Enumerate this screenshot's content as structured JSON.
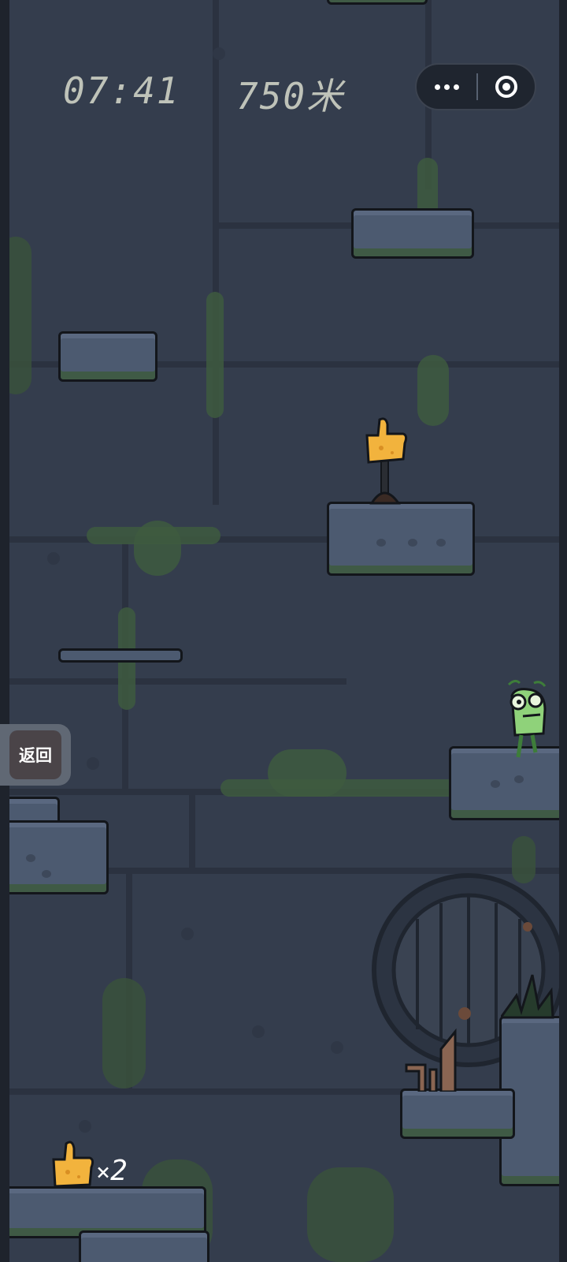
{
  "hud": {
    "timer": "07:41",
    "height": "750米"
  },
  "capsule": {
    "more_icon": "more-dots-icon",
    "close_icon": "target-close-icon"
  },
  "back_button": {
    "label": "返回"
  },
  "powerup_counter": {
    "icon": "thumbs-up-icon",
    "prefix": "×",
    "count": "2"
  },
  "colors": {
    "background": "#343d4d",
    "platform": "#4c5a70",
    "moss": "#3e5a3f",
    "hud_text": "#bfc3b9",
    "thumb": "#f2b33d"
  }
}
